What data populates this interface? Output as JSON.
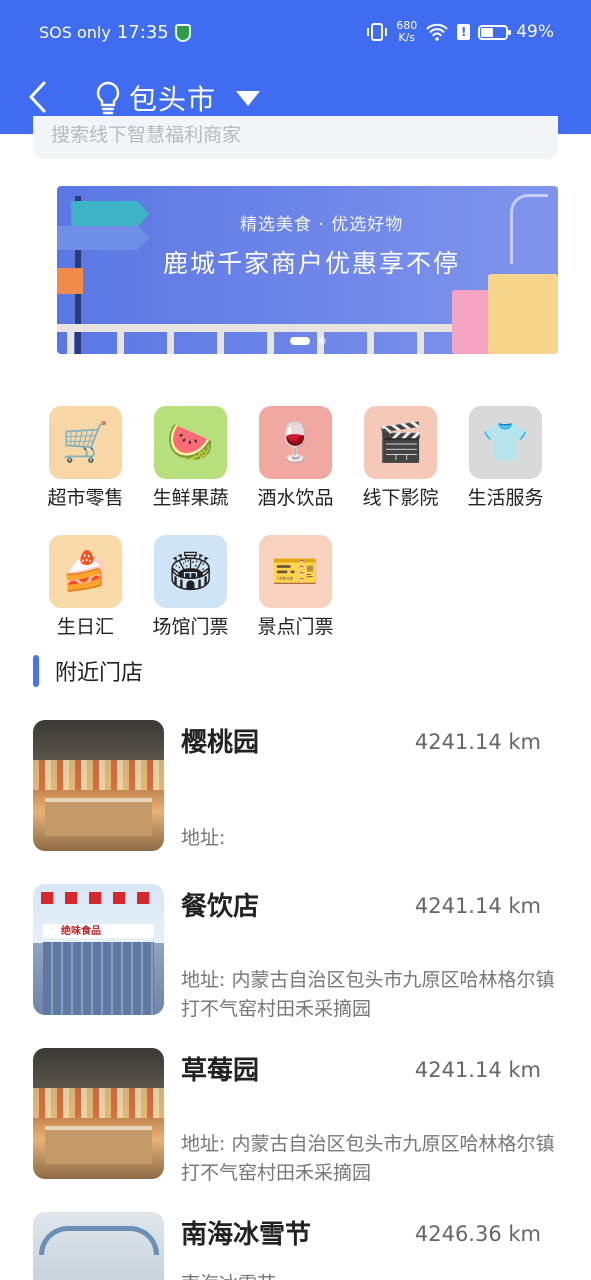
{
  "status_bar": {
    "carrier": "SOS only",
    "time": "17:35",
    "net_speed_value": "680",
    "net_speed_unit": "K/s",
    "battery": "49%",
    "battery_level": 0.49
  },
  "navbar": {
    "city": "包头市"
  },
  "search": {
    "placeholder": "搜索线下智慧福利商家"
  },
  "banner": {
    "subtitle": "精选美食 · 优选好物",
    "title": "鹿城千家商户优惠享不停",
    "dots": 2,
    "active_dot": 0
  },
  "categories": [
    {
      "label": "超市零售",
      "icon": "shopping-cart-icon",
      "glyph": "🛒",
      "bg": "#f6d7a5"
    },
    {
      "label": "生鲜果蔬",
      "icon": "watermelon-icon",
      "glyph": "🍉",
      "bg": "#b7e07c"
    },
    {
      "label": "酒水饮品",
      "icon": "drinks-icon",
      "glyph": "🍷",
      "bg": "#f0a8a0"
    },
    {
      "label": "线下影院",
      "icon": "clapperboard-icon",
      "glyph": "🎬",
      "bg": "#f6c8b8"
    },
    {
      "label": "生活服务",
      "icon": "tshirt-icon",
      "glyph": "👕",
      "bg": "#d9d9d9"
    },
    {
      "label": "生日汇",
      "icon": "cake-icon",
      "glyph": "🍰",
      "bg": "#f8d9a8"
    },
    {
      "label": "场馆门票",
      "icon": "stadium-icon",
      "glyph": "🏟",
      "bg": "#cfe5f7"
    },
    {
      "label": "景点门票",
      "icon": "ticket-icon",
      "glyph": "🎫",
      "bg": "#f6d2bf"
    }
  ],
  "nearby": {
    "title": "附近门店",
    "stores": [
      {
        "name": "樱桃园",
        "distance": "4241.14 km",
        "address": "地址:",
        "image": "market"
      },
      {
        "name": "餐饮店",
        "distance": "4241.14 km",
        "address": "地址: 内蒙古自治区包头市九原区哈林格尔镇打不气窑村田禾采摘园",
        "image": "building",
        "image_text": "绝味食品"
      },
      {
        "name": "草莓园",
        "distance": "4241.14 km",
        "address": "地址: 内蒙古自治区包头市九原区哈林格尔镇打不气窑村田禾采摘园",
        "image": "market"
      },
      {
        "name": "南海冰雪节",
        "distance": "4246.36 km",
        "address": "南海冰雪节",
        "image": "park"
      }
    ]
  }
}
